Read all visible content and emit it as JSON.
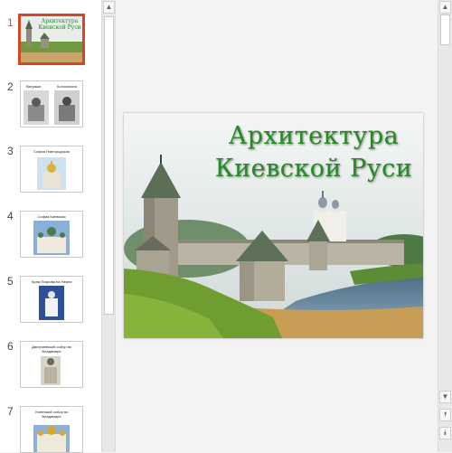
{
  "thumbnails": [
    {
      "num": "1",
      "caption": "Архитектура Киевской Руси",
      "selected": true
    },
    {
      "num": "2",
      "caption": ""
    },
    {
      "num": "3",
      "caption": "София Новгородская"
    },
    {
      "num": "4",
      "caption": "Софиа Киевская"
    },
    {
      "num": "5",
      "caption": "Храм Покрова на Нерли"
    },
    {
      "num": "6",
      "caption": "Дмитриевский собор во Владимире"
    },
    {
      "num": "7",
      "caption": "Успенский собор во Владимире"
    }
  ],
  "thumb2": {
    "left_caption": "Витражи",
    "right_caption": "Колокольня"
  },
  "slide": {
    "title_line1": "Архитектура",
    "title_line2": "Киевской  Руси"
  },
  "scroll": {
    "up_glyph": "▲",
    "down_glyph": "▼",
    "prev_slide_glyph": "⯭",
    "next_slide_glyph": "⯯"
  },
  "colors": {
    "selected_border": "#d24726",
    "title_green": "#228b22"
  }
}
